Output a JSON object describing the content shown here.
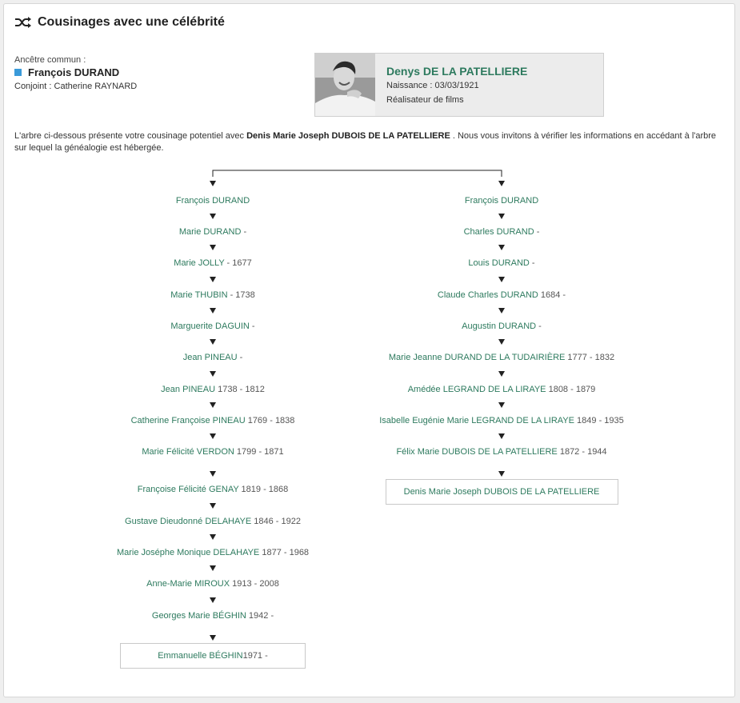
{
  "title": "Cousinages avec une célébrité",
  "ancestor": {
    "label": "Ancêtre commun :",
    "name": "François DURAND",
    "spouse": "Conjoint : Catherine RAYNARD"
  },
  "celebrity": {
    "name": "Denys DE LA PATELLIERE",
    "birth": "Naissance : 03/03/1921",
    "profession": "Réalisateur de films"
  },
  "intro": {
    "before": "L'arbre ci-dessous présente votre cousinage potentiel avec ",
    "bold": "Denis Marie Joseph DUBOIS DE LA PATELLIERE",
    "after": " . Nous vous invitons à vérifier les informations en accédant à l'arbre sur lequel la généalogie est hébergée."
  },
  "left_branch": [
    {
      "name": "François DURAND",
      "dates": ""
    },
    {
      "name": "Marie DURAND",
      "dates": " -"
    },
    {
      "name": "Marie JOLLY",
      "dates": " - 1677"
    },
    {
      "name": "Marie THUBIN",
      "dates": " - 1738"
    },
    {
      "name": "Marguerite DAGUIN",
      "dates": " -"
    },
    {
      "name": "Jean PINEAU",
      "dates": " -"
    },
    {
      "name": "Jean PINEAU",
      "dates": " 1738 - 1812"
    },
    {
      "name": "Catherine Françoise PINEAU",
      "dates": " 1769 - 1838"
    },
    {
      "name": "Marie Félicité VERDON",
      "dates": " 1799 - 1871"
    },
    {
      "name": "Françoise Félicité GENAY",
      "dates": " 1819 - 1868"
    },
    {
      "name": "Gustave Dieudonné DELAHAYE",
      "dates": " 1846 - 1922"
    },
    {
      "name": "Marie Joséphe Monique DELAHAYE",
      "dates": " 1877 - 1968"
    },
    {
      "name": "Anne-Marie MIROUX",
      "dates": " 1913 - 2008"
    },
    {
      "name": "Georges Marie BÉGHIN",
      "dates": " 1942 -"
    },
    {
      "name": "Emmanuelle BÉGHIN",
      "dates": " 1971 -"
    }
  ],
  "right_branch": [
    {
      "name": "François DURAND",
      "dates": ""
    },
    {
      "name": "Charles DURAND",
      "dates": " -"
    },
    {
      "name": "Louis DURAND",
      "dates": " -"
    },
    {
      "name": "Claude Charles DURAND",
      "dates": " 1684 -"
    },
    {
      "name": "Augustin DURAND",
      "dates": " -"
    },
    {
      "name": "Marie Jeanne DURAND DE LA TUDAIRIÈRE",
      "dates": " 1777 - 1832"
    },
    {
      "name": "Amédée LEGRAND DE LA LIRAYE",
      "dates": " 1808 - 1879"
    },
    {
      "name": "Isabelle Eugénie Marie LEGRAND DE LA LIRAYE",
      "dates": " 1849 - 1935"
    },
    {
      "name": "Félix Marie DUBOIS DE LA PATELLIERE",
      "dates": " 1872 - 1944"
    },
    {
      "name": "Denis Marie Joseph DUBOIS DE LA PATELLIERE",
      "dates": ""
    }
  ],
  "colors": {
    "accent": "#2d7a5e",
    "ancestor_marker": "#3a9ad9"
  }
}
